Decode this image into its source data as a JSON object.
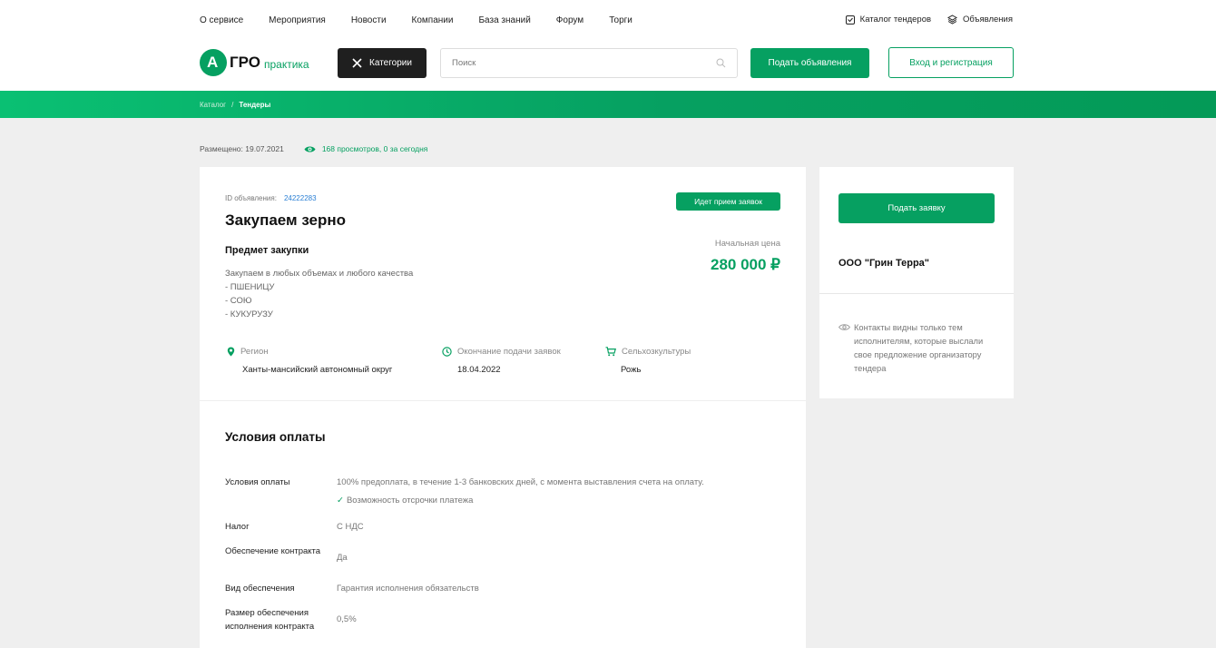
{
  "topnav": {
    "links": [
      "О сервисе",
      "Мероприятия",
      "Новости",
      "Компании",
      "База знаний",
      "Форум",
      "Торги"
    ],
    "right": {
      "catalog_label": "Каталог тендеров",
      "ads_label": "Объявления"
    }
  },
  "header": {
    "logo": {
      "letter": "А",
      "bold": "ГРО",
      "suffix": "практика"
    },
    "categories_label": "Категории",
    "search_placeholder": "Поиск",
    "post_label": "Подать объявления",
    "login_label": "Вход и регистрация"
  },
  "breadcrumb": {
    "items": [
      "Каталог",
      "Тендеры"
    ],
    "separator": "/"
  },
  "meta": {
    "posted": "Размещено: 19.07.2021",
    "views": "168 просмотров, 0 за сегодня"
  },
  "tender": {
    "id_label": "ID объявления:",
    "id_value": "24222283",
    "status": "Идет прием заявок",
    "title": "Закупаем зерно",
    "subject_heading": "Предмет закупки",
    "description": [
      "Закупаем в любых объемах и любого качества",
      "- ПШЕНИЦУ",
      "- СОЮ",
      "- КУКУРУЗУ"
    ],
    "price_label": "Начальная цена",
    "price": "280 000 ₽",
    "info": {
      "region_label": "Регион",
      "region_value": "Ханты-мансийский автономный округ",
      "deadline_label": "Окончание подачи заявок",
      "deadline_value": "18.04.2022",
      "crops_label": "Сельхозкультуры",
      "crops_value": "Рожь"
    }
  },
  "conditions": {
    "heading": "Условия оплаты",
    "rows": [
      {
        "key": "Условия оплаты",
        "value": "100% предоплата, в течение 1-3 банковских дней, с момента выставления счета на оплату.",
        "extra": "Возможность отсрочки платежа"
      },
      {
        "key": "Налог",
        "value": "С НДС"
      },
      {
        "key": "Обеспечение контракта",
        "value": "Да"
      },
      {
        "key": "Вид обеспечения",
        "value": "Гарантия исполнения обязательств"
      },
      {
        "key": "Размер обеспечения исполнения контракта",
        "value": "0,5%"
      }
    ]
  },
  "sidebar": {
    "apply_label": "Подать заявку",
    "organization": "ООО \"Грин Терра\"",
    "note": "Контакты видны только тем исполнителям, которые выслали свое предложение организатору тендера"
  },
  "colors": {
    "accent": "#06a061",
    "dark_button": "#1f1f1f",
    "link": "#2a7fd4",
    "background": "#efefef"
  },
  "icons": [
    "tender-catalog-icon",
    "layers-icon",
    "close-icon",
    "search-icon",
    "eye-icon",
    "location-pin-icon",
    "clock-icon",
    "cart-icon",
    "check-icon"
  ]
}
